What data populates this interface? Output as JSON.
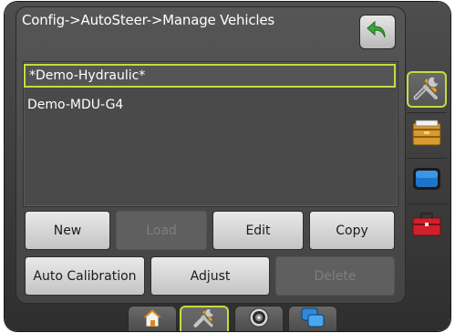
{
  "header": {
    "breadcrumb": "Config->AutoSteer->Manage Vehicles"
  },
  "vehicles": [
    {
      "label": "*Demo-Hydraulic*",
      "selected": true
    },
    {
      "label": "Demo-MDU-G4",
      "selected": false
    }
  ],
  "actions": {
    "new": "New",
    "load": "Load",
    "edit": "Edit",
    "copy": "Copy",
    "auto_calibration": "Auto Calibration",
    "adjust": "Adjust",
    "delete": "Delete"
  },
  "side_tabs": [
    {
      "icon": "tools-icon",
      "active": true
    },
    {
      "icon": "data-folder-icon",
      "active": false
    },
    {
      "icon": "console-icon",
      "active": false
    },
    {
      "icon": "toolbox-icon",
      "active": false
    }
  ],
  "bottom_tabs": [
    {
      "icon": "home-icon",
      "active": false
    },
    {
      "icon": "tools-icon",
      "active": true
    },
    {
      "icon": "gps-icon",
      "active": false
    },
    {
      "icon": "windows-icon",
      "active": false
    }
  ],
  "colors": {
    "accent": "#c4dc3f",
    "panel": "#4a4a4a",
    "back_arrow": "#3aa637"
  }
}
